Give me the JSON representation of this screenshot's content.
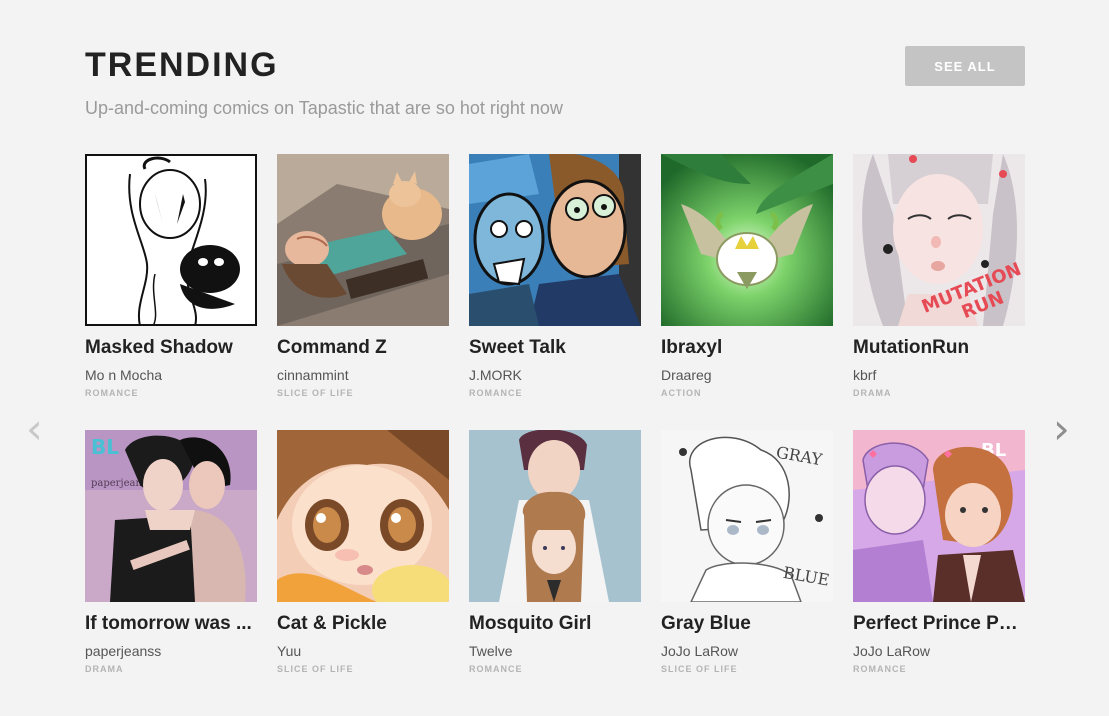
{
  "header": {
    "title": "TRENDING",
    "subtitle": "Up-and-coming comics on Tapastic that are so hot right now",
    "see_all_label": "SEE ALL"
  },
  "nav": {
    "prev_glyph": "‹",
    "next_glyph": "›"
  },
  "comics": [
    {
      "title": "Masked Shadow",
      "author": "Mo n Mocha",
      "genre": "ROMANCE",
      "icon": "masked-figure-thumbnail"
    },
    {
      "title": "Command Z",
      "author": "cinnammint",
      "genre": "SLICE OF LIFE",
      "icon": "sleeping-with-cat-thumbnail"
    },
    {
      "title": "Sweet Talk",
      "author": "J.MORK",
      "genre": "ROMANCE",
      "icon": "two-characters-thumbnail"
    },
    {
      "title": "Ibraxyl",
      "author": "Draareg",
      "genre": "ACTION",
      "icon": "winged-crest-thumbnail"
    },
    {
      "title": "MutationRun",
      "author": "kbrf",
      "genre": "DRAMA",
      "icon": "girl-portrait-thumbnail"
    },
    {
      "title": "If tomorrow was ...",
      "author": "paperjeanss",
      "genre": "DRAMA",
      "icon": "embracing-couple-thumbnail"
    },
    {
      "title": "Cat & Pickle",
      "author": "Yuu",
      "genre": "SLICE OF LIFE",
      "icon": "teary-eyed-boy-thumbnail"
    },
    {
      "title": "Mosquito Girl",
      "author": "Twelve",
      "genre": "ROMANCE",
      "icon": "stacked-students-thumbnail"
    },
    {
      "title": "Gray Blue",
      "author": "JoJo LaRow",
      "genre": "SLICE OF LIFE",
      "icon": "sketch-boy-thumbnail"
    },
    {
      "title": "Perfect Prince Proj...",
      "author": "JoJo LaRow",
      "genre": "ROMANCE",
      "icon": "two-boys-purple-thumbnail"
    }
  ],
  "thumb_text": {
    "bl_badge": "BL",
    "gray_word": "GRAY",
    "blue_word": "BLUE",
    "mutation_word": "MUTATION",
    "run_word": "RUN",
    "paper_sig": "paperjeans"
  },
  "colors": {
    "background": "#f3f3f3",
    "see_all_bg": "#c4c4c4",
    "title": "#222222",
    "subtitle": "#9a9a9a",
    "genre": "#b4b4b4"
  }
}
